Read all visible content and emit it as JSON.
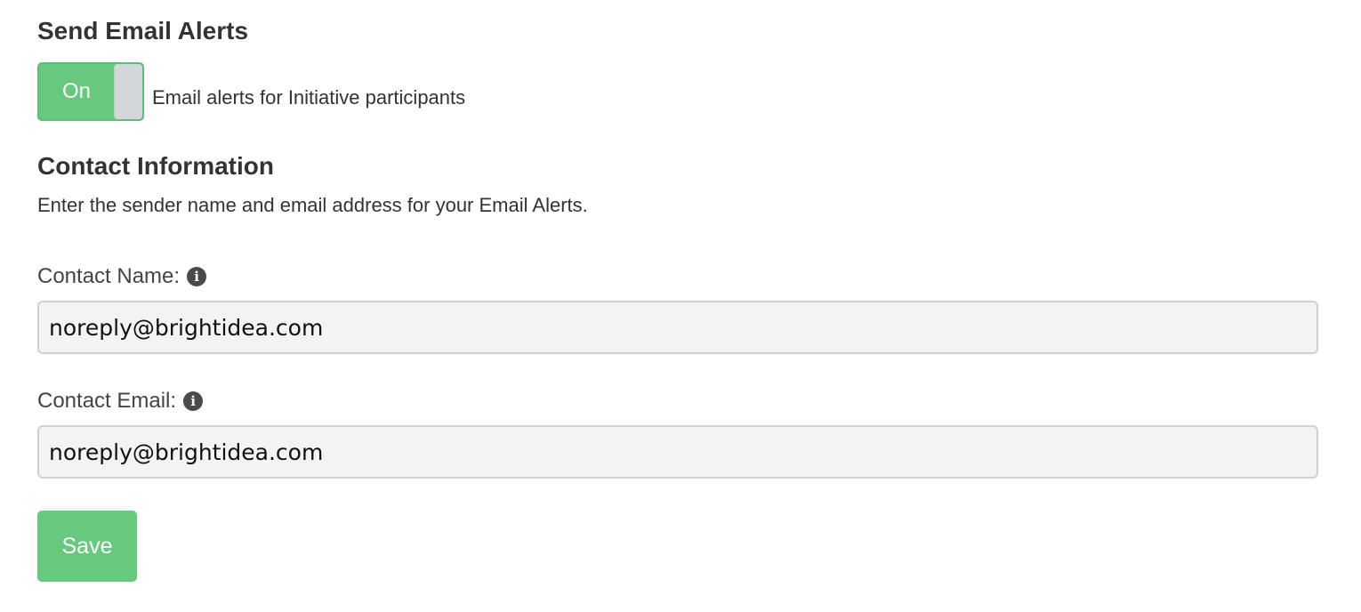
{
  "alerts_section": {
    "title": "Send Email Alerts",
    "toggle_state": "On",
    "toggle_caption": "Email alerts for Initiative participants"
  },
  "contact_section": {
    "title": "Contact Information",
    "description": "Enter the sender name and email address for your Email Alerts.",
    "name_label": "Contact Name:",
    "name_value": "noreply@brightidea.com",
    "email_label": "Contact Email:",
    "email_value": "noreply@brightidea.com"
  },
  "icons": {
    "info": "info-icon"
  },
  "save_label": "Save",
  "colors": {
    "accent_green": "#66c97d",
    "toggle_knob": "#d4d7da",
    "input_bg": "#f3f3f3",
    "text": "#333333"
  }
}
